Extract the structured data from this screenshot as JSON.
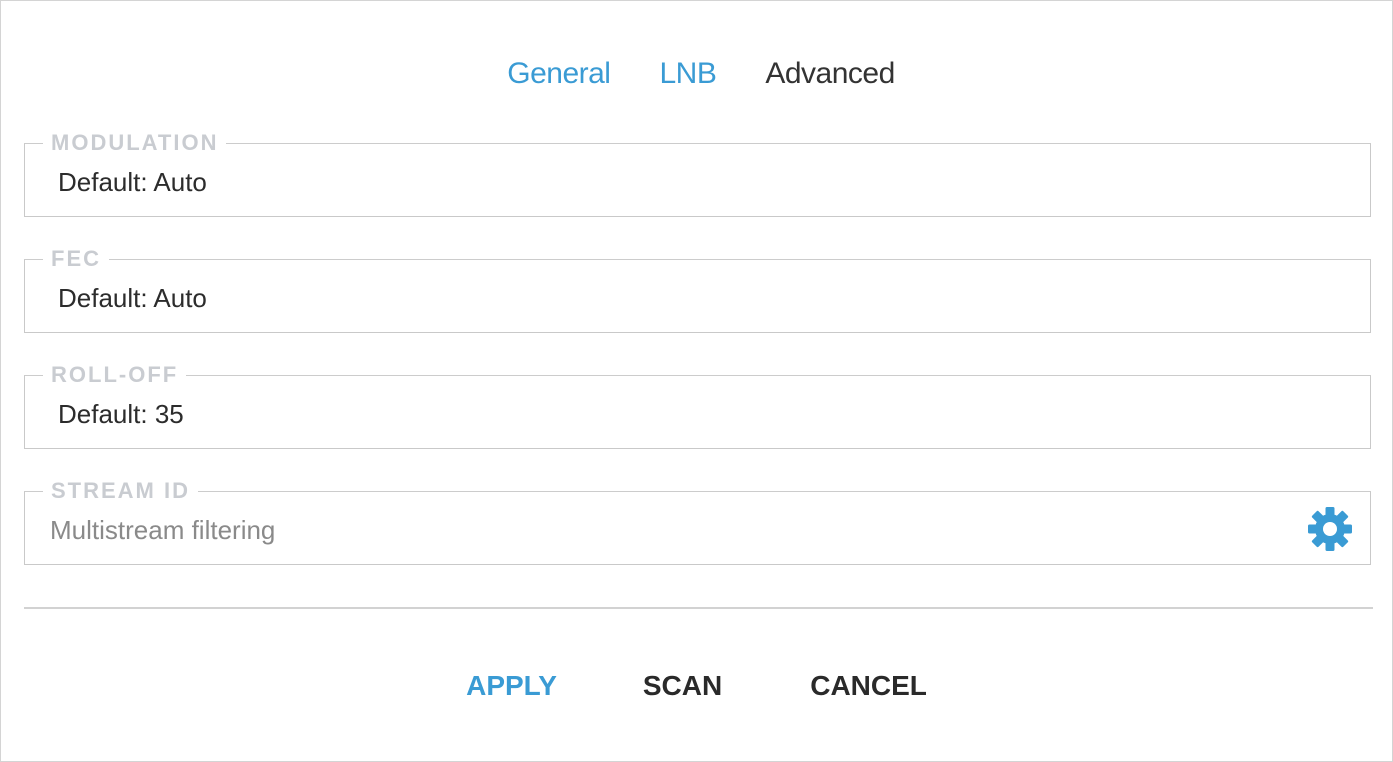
{
  "tabs": [
    {
      "label": "General",
      "state": "link"
    },
    {
      "label": "LNB",
      "state": "link"
    },
    {
      "label": "Advanced",
      "state": "active"
    }
  ],
  "fields": {
    "modulation": {
      "legend": "MODULATION",
      "value": "Default: Auto"
    },
    "fec": {
      "legend": "FEC",
      "value": "Default: Auto"
    },
    "rolloff": {
      "legend": "ROLL-OFF",
      "value": "Default: 35"
    },
    "stream_id": {
      "legend": "STREAM ID",
      "value": "Multistream filtering",
      "icon": "gear-icon"
    }
  },
  "actions": {
    "apply": "APPLY",
    "scan": "SCAN",
    "cancel": "CANCEL"
  },
  "colors": {
    "accent": "#3a9bd4",
    "legend": "#c9ccd1",
    "text": "#2c2c2c",
    "placeholder": "#8a8a8a"
  }
}
